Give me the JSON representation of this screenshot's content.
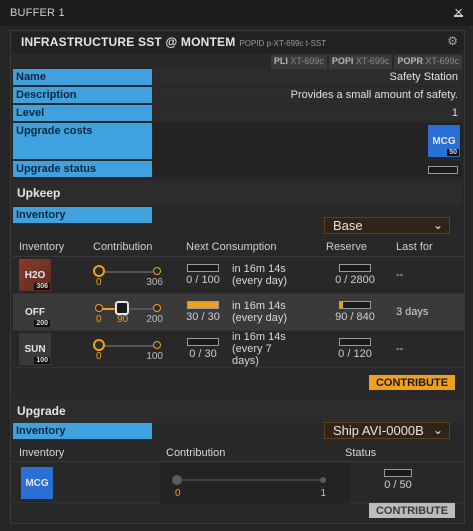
{
  "window": {
    "title": "BUFFER 1"
  },
  "header": {
    "title": "INFRASTRUCTURE SST @ MONTEM",
    "popid": "POPID p-XT-699c t-SST",
    "ids": [
      {
        "k": "PLI",
        "v": "XT-699c"
      },
      {
        "k": "POPI",
        "v": "XT-699c"
      },
      {
        "k": "POPR",
        "v": "XT-699c"
      }
    ]
  },
  "info": {
    "name_label": "Name",
    "name_value": "Safety Station",
    "desc_label": "Description",
    "desc_value": "Provides a small amount of safety.",
    "level_label": "Level",
    "level_value": "1",
    "costs_label": "Upgrade costs",
    "cost_ticker": "MCG",
    "cost_amount": "50",
    "status_label": "Upgrade status"
  },
  "upkeep": {
    "section": "Upkeep",
    "inventory_label": "Inventory",
    "inventory_selected": "Base",
    "columns": [
      "Inventory",
      "Contribution",
      "Next Consumption",
      "Reserve",
      "Last for"
    ],
    "rows": [
      {
        "ticker": "H2O",
        "count": "306",
        "min": "0",
        "mid": "",
        "max": "306",
        "cons": "0 / 100",
        "cons_fill": 0,
        "when": "in 16m 14s (every day)",
        "reserve": "0 / 2800",
        "reserve_fill": 0,
        "last": "--"
      },
      {
        "ticker": "OFF",
        "count": "200",
        "min": "0",
        "mid": "90",
        "max": "200",
        "cons": "30 / 30",
        "cons_fill": 1,
        "when": "in 16m 14s (every day)",
        "reserve": "90 / 840",
        "reserve_fill": 0.107,
        "last": "3 days"
      },
      {
        "ticker": "SUN",
        "count": "100",
        "min": "0",
        "mid": "",
        "max": "100",
        "cons": "0 / 30",
        "cons_fill": 0,
        "when": "in 16m 14s (every 7 days)",
        "reserve": "0 / 120",
        "reserve_fill": 0,
        "last": "--"
      }
    ],
    "contribute": "CONTRIBUTE"
  },
  "upgrade": {
    "section": "Upgrade",
    "inventory_label": "Inventory",
    "inventory_selected": "Ship AVI-0000B",
    "columns": [
      "Inventory",
      "Contribution",
      "Status"
    ],
    "row": {
      "ticker": "MCG",
      "min": "0",
      "max": "1",
      "status": "0 / 50"
    },
    "contribute": "CONTRIBUTE"
  },
  "colors": {
    "accent": "#f0a020",
    "label_blue": "#3fa2de",
    "mcg_blue": "#2a6fd6"
  }
}
